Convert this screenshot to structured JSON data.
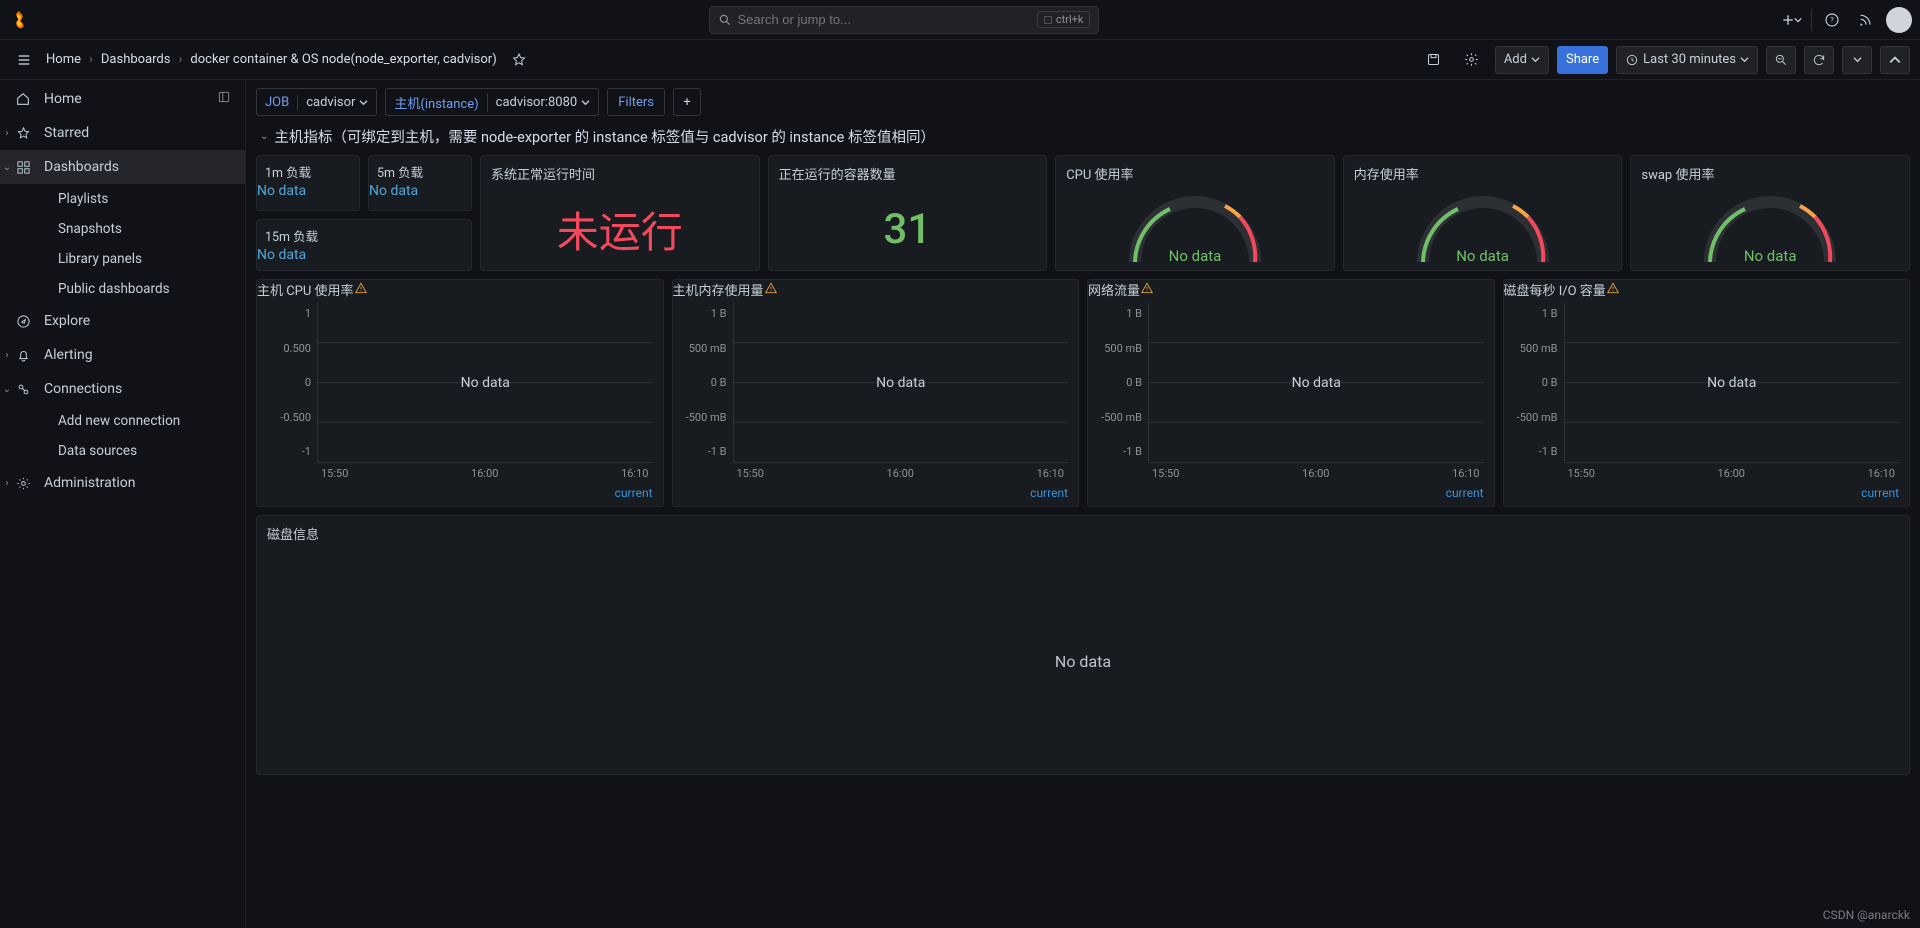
{
  "search": {
    "placeholder": "Search or jump to...",
    "kbd": "ctrl+k"
  },
  "breadcrumbs": {
    "home": "Home",
    "dashboards": "Dashboards",
    "current": "docker container & OS node(node_exporter, cadvisor)"
  },
  "toolbar": {
    "add": "Add",
    "share": "Share",
    "timerange": "Last 30 minutes"
  },
  "sidebar": {
    "home": "Home",
    "starred": "Starred",
    "dashboards": "Dashboards",
    "playlists": "Playlists",
    "snapshots": "Snapshots",
    "library": "Library panels",
    "publicdash": "Public dashboards",
    "explore": "Explore",
    "alerting": "Alerting",
    "connections": "Connections",
    "addconn": "Add new connection",
    "datasources": "Data sources",
    "admin": "Administration"
  },
  "vars": {
    "jobLabel": "JOB",
    "jobValue": "cadvisor",
    "hostLabel": "主机(instance)",
    "hostValue": "cadvisor:8080",
    "filters": "Filters"
  },
  "row": {
    "title": "主机指标（可绑定到主机，需要 node-exporter 的 instance 标签值与 cadvisor 的 instance 标签值相同）"
  },
  "panels": {
    "load1m": "1m 负载",
    "load5m": "5m 负载",
    "load15m": "15m 负载",
    "uptime": "系统正常运行时间",
    "uptimeValue": "未运行",
    "running": "正在运行的容器数量",
    "runningValue": "31",
    "cpu": "CPU 使用率",
    "mem": "内存使用率",
    "swap": "swap 使用率",
    "nodata": "No data",
    "hostcpu": "主机 CPU 使用率",
    "hostmem": "主机内存使用量",
    "nettraffic": "网络流量",
    "diskio": "磁盘每秒 I/O 容量",
    "diskinfo": "磁盘信息",
    "current": "current"
  },
  "chart_data": [
    {
      "panel": "hostcpu",
      "type": "line",
      "ylabels": [
        "1",
        "0.500",
        "0",
        "-0.500",
        "-1"
      ],
      "xlabels": [
        "15:50",
        "16:00",
        "16:10"
      ],
      "nodata": "No data"
    },
    {
      "panel": "hostmem",
      "type": "line",
      "ylabels": [
        "1 B",
        "500 mB",
        "0 B",
        "-500 mB",
        "-1 B"
      ],
      "xlabels": [
        "15:50",
        "16:00",
        "16:10"
      ],
      "nodata": "No data"
    },
    {
      "panel": "nettraffic",
      "type": "line",
      "ylabels": [
        "1 B",
        "500 mB",
        "0 B",
        "-500 mB",
        "-1 B"
      ],
      "xlabels": [
        "15:50",
        "16:00",
        "16:10"
      ],
      "nodata": "No data"
    },
    {
      "panel": "diskio",
      "type": "line",
      "ylabels": [
        "1 B",
        "500 mB",
        "0 B",
        "-500 mB",
        "-1 B"
      ],
      "xlabels": [
        "15:50",
        "16:00",
        "16:10"
      ],
      "nodata": "No data"
    }
  ],
  "watermark": "CSDN @anarckk"
}
